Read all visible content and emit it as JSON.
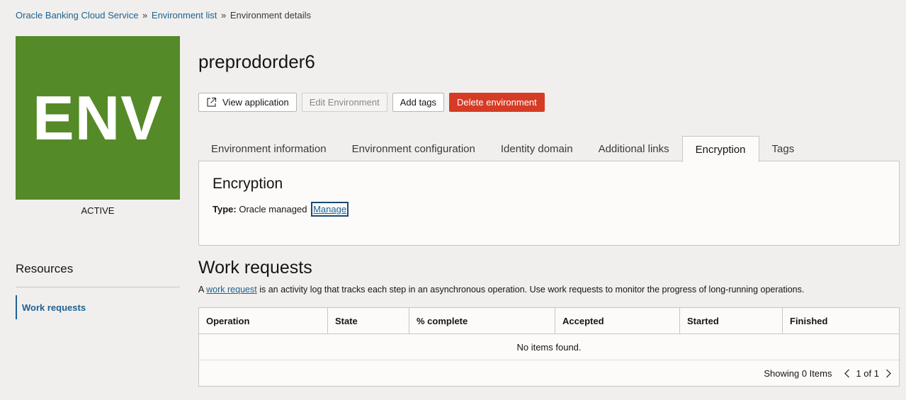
{
  "breadcrumb": {
    "items": [
      "Oracle Banking Cloud Service",
      "Environment list"
    ],
    "separator": "»",
    "current": "Environment details"
  },
  "env_tile": {
    "text": "ENV",
    "color": "#548a27"
  },
  "env_status": "ACTIVE",
  "page_title": "preprodorder6",
  "actions": {
    "view_application": "View application",
    "edit_environment": "Edit Environment",
    "add_tags": "Add tags",
    "delete_environment": "Delete environment"
  },
  "tabs": [
    {
      "label": "Environment information"
    },
    {
      "label": "Environment configuration"
    },
    {
      "label": "Identity domain"
    },
    {
      "label": "Additional links"
    },
    {
      "label": "Encryption"
    },
    {
      "label": "Tags"
    }
  ],
  "active_tab": "Encryption",
  "encryption": {
    "heading": "Encryption",
    "type_label": "Type:",
    "type_value": "Oracle managed",
    "manage_link": "Manage"
  },
  "resources": {
    "title": "Resources",
    "items": [
      {
        "label": "Work requests"
      }
    ]
  },
  "work_requests": {
    "title": "Work requests",
    "desc_prefix": "A",
    "desc_link": "work request",
    "desc_suffix": "is an activity log that tracks each step in an asynchronous operation. Use work requests to monitor the progress of long-running operations.",
    "columns": [
      "Operation",
      "State",
      "% complete",
      "Accepted",
      "Started",
      "Finished"
    ],
    "empty_text": "No items found.",
    "showing": "Showing 0 Items",
    "page": "1 of 1"
  },
  "colors": {
    "accent": "#1e6191",
    "danger": "#d63b25",
    "brand": "#548a27"
  }
}
